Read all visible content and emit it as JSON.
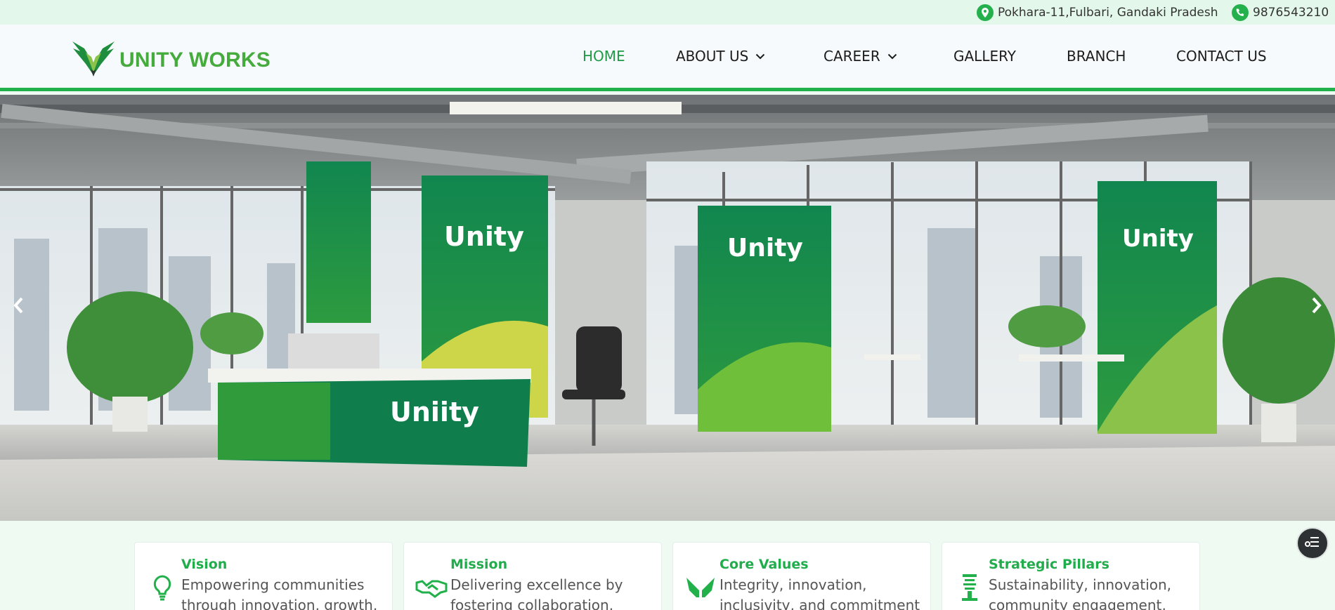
{
  "topbar": {
    "address": "Pokhara-11,Fulbari, Gandaki Pradesh",
    "address_icon": "location-pin-icon",
    "phone": "9876543210",
    "phone_icon": "phone-icon"
  },
  "header": {
    "brand": "UNITY WORKS",
    "logo_icon": "wings-logo-icon",
    "nav": [
      {
        "label": "HOME",
        "active": true
      },
      {
        "label": "ABOUT US",
        "dropdown": true
      },
      {
        "label": "CAREER",
        "dropdown": true
      },
      {
        "label": "GALLERY"
      },
      {
        "label": "BRANCH"
      },
      {
        "label": "CONTACT US"
      }
    ]
  },
  "hero": {
    "banner_texts": [
      "Unity",
      "Unity",
      "Unity",
      "Uniity"
    ],
    "prev_icon": "chevron-left-icon",
    "next_icon": "chevron-right-icon"
  },
  "cards": [
    {
      "title": "Vision",
      "icon": "lightbulb-icon",
      "description": "Empowering communities through innovation, growth,"
    },
    {
      "title": "Mission",
      "icon": "handshake-icon",
      "description": "Delivering excellence by fostering collaboration, trust,"
    },
    {
      "title": "Core Values",
      "icon": "hands-icon",
      "description": "Integrity, innovation, inclusivity, and commitment"
    },
    {
      "title": "Strategic Pillars",
      "icon": "pillar-icon",
      "description": "Sustainability, innovation, community engagement, and"
    }
  ],
  "colors": {
    "brand_green": "#45ab3c",
    "accent_green": "#22b04b",
    "topbar_bg": "#e3f8ea",
    "banner_green": "#138a52"
  }
}
